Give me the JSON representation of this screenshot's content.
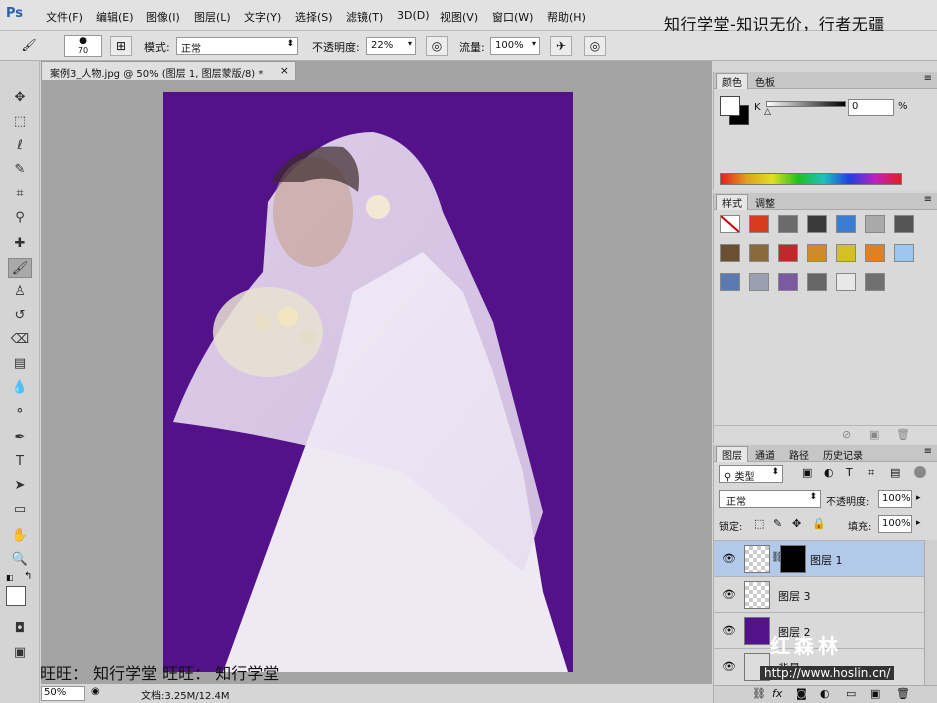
{
  "menubar": {
    "logo": "Ps",
    "items": [
      "文件(F)",
      "编辑(E)",
      "图像(I)",
      "图层(L)",
      "文字(Y)",
      "选择(S)",
      "滤镜(T)",
      "3D(D)",
      "视图(V)",
      "窗口(W)",
      "帮助(H)"
    ],
    "brand": "知行学堂-知识无价，行者无疆"
  },
  "options": {
    "brush_size": "70",
    "mode_label": "模式:",
    "mode_value": "正常",
    "opacity_label": "不透明度:",
    "opacity_value": "22%",
    "flow_label": "流量:",
    "flow_value": "100%"
  },
  "document": {
    "tab_title": "案例3_人物.jpg @ 50% (图层 1, 图层蒙版/8) *",
    "tab_close": "×",
    "zoom": "50%",
    "doc_info": "文档:3.25M/12.4M",
    "overlay": "旺旺： 知行学堂  旺旺： 知行学堂",
    "canvas_color": "#54128a"
  },
  "color_panel": {
    "tabs": [
      "颜色",
      "色板"
    ],
    "channel": "K",
    "value": "0",
    "unit": "%"
  },
  "styles_panel": {
    "tabs": [
      "样式",
      "调整"
    ],
    "swatches": [
      "#ffffff",
      "#d63b1f",
      "#6b6b6b",
      "#3a3a3a",
      "#3a7ed4",
      "#a9a9a9",
      "#555555",
      "#6a5030",
      "#8a6a3a",
      "#c0282a",
      "#d08a2a",
      "#d4c020",
      "#e08020",
      "#9cc8f0",
      "#5a7ab0",
      "#9aa0b0",
      "#7a5aa0",
      "#666666",
      "#e8e8e8",
      "#707070"
    ]
  },
  "layers_panel": {
    "tabs": [
      "图层",
      "通道",
      "路径",
      "历史记录"
    ],
    "filter": "类型",
    "blend_mode": "正常",
    "opacity_label": "不透明度:",
    "opacity_value": "100%",
    "lock_label": "锁定:",
    "fill_label": "填充:",
    "fill_value": "100%",
    "layers": [
      {
        "name": "图层 1"
      },
      {
        "name": "图层 3"
      },
      {
        "name": "图层 2"
      },
      {
        "name": "背景"
      }
    ]
  },
  "watermark": {
    "title": "红森林",
    "url": "http://www.hoslin.cn/"
  }
}
